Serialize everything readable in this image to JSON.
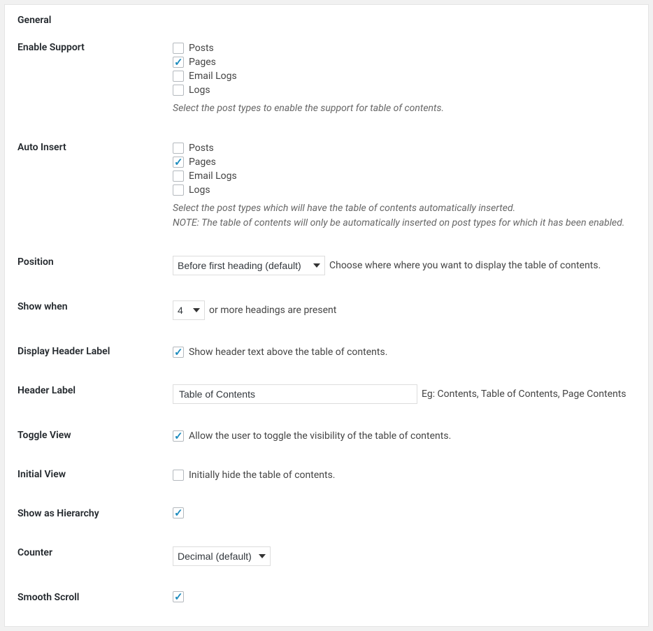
{
  "section_title": "General",
  "enable_support": {
    "label": "Enable Support",
    "options": [
      {
        "label": "Posts",
        "checked": false
      },
      {
        "label": "Pages",
        "checked": true
      },
      {
        "label": "Email Logs",
        "checked": false
      },
      {
        "label": "Logs",
        "checked": false
      }
    ],
    "desc": "Select the post types to enable the support for table of contents."
  },
  "auto_insert": {
    "label": "Auto Insert",
    "options": [
      {
        "label": "Posts",
        "checked": false
      },
      {
        "label": "Pages",
        "checked": true
      },
      {
        "label": "Email Logs",
        "checked": false
      },
      {
        "label": "Logs",
        "checked": false
      }
    ],
    "desc1": "Select the post types which will have the table of contents automatically inserted.",
    "desc2": "NOTE: The table of contents will only be automatically inserted on post types for which it has been enabled."
  },
  "position": {
    "label": "Position",
    "value": "Before first heading (default)",
    "note": "Choose where where you want to display the table of contents."
  },
  "show_when": {
    "label": "Show when",
    "value": "4",
    "note": "or more headings are present"
  },
  "display_header": {
    "label": "Display Header Label",
    "checked": true,
    "text": "Show header text above the table of contents."
  },
  "header_label": {
    "label": "Header Label",
    "value": "Table of Contents",
    "note": "Eg: Contents, Table of Contents, Page Contents"
  },
  "toggle_view": {
    "label": "Toggle View",
    "checked": true,
    "text": "Allow the user to toggle the visibility of the table of contents."
  },
  "initial_view": {
    "label": "Initial View",
    "checked": false,
    "text": "Initially hide the table of contents."
  },
  "hierarchy": {
    "label": "Show as Hierarchy",
    "checked": true
  },
  "counter": {
    "label": "Counter",
    "value": "Decimal (default)"
  },
  "smooth_scroll": {
    "label": "Smooth Scroll",
    "checked": true
  }
}
